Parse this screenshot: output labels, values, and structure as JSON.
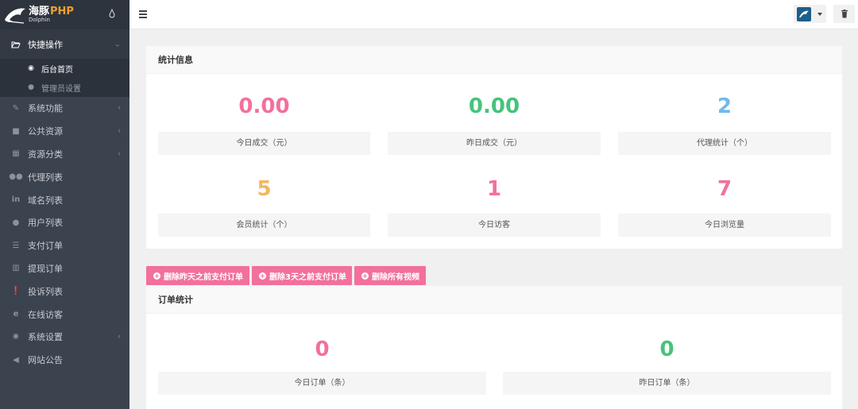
{
  "brand": {
    "name_cn": "海豚",
    "name_php": "PHP",
    "sub": "Dolphin"
  },
  "sidebar": {
    "items": [
      {
        "label": "快捷操作",
        "icon": "folder-open-icon",
        "open": true
      },
      {
        "label": "系统功能",
        "icon": "wrench-icon",
        "chevron": true
      },
      {
        "label": "公共资源",
        "icon": "video-camera-icon",
        "chevron": true
      },
      {
        "label": "资源分类",
        "icon": "grid-icon",
        "chevron": true
      },
      {
        "label": "代理列表",
        "icon": "users-icon"
      },
      {
        "label": "域名列表",
        "icon": "linkedin-icon"
      },
      {
        "label": "用户列表",
        "icon": "user-icon"
      },
      {
        "label": "支付订单",
        "icon": "database-icon"
      },
      {
        "label": "提现订单",
        "icon": "bank-icon"
      },
      {
        "label": "投诉列表",
        "icon": "exclamation-circle-icon"
      },
      {
        "label": "在线访客",
        "icon": "internet-explorer-icon"
      },
      {
        "label": "系统设置",
        "icon": "gear-icon",
        "chevron": true
      },
      {
        "label": "网站公告",
        "icon": "bullhorn-icon"
      }
    ],
    "sub_items": [
      {
        "label": "后台首页",
        "icon": "dashboard-icon",
        "active": true
      },
      {
        "label": "管理员设置",
        "icon": "user-icon"
      }
    ]
  },
  "stats_panel": {
    "title": "统计信息",
    "stats": [
      {
        "value": "0.00",
        "label": "今日成交（元）",
        "color": "#f2709c"
      },
      {
        "value": "0.00",
        "label": "昨日成交（元）",
        "color": "#46c37b"
      },
      {
        "value": "2",
        "label": "代理统计（个）",
        "color": "#70b9eb"
      },
      {
        "value": "5",
        "label": "会员统计（个）",
        "color": "#f3b760"
      },
      {
        "value": "1",
        "label": "今日访客",
        "color": "#f2709c"
      },
      {
        "value": "7",
        "label": "今日浏览量",
        "color": "#f2709c"
      }
    ]
  },
  "actions": [
    "删除昨天之前支付订单",
    "删除3天之前支付订单",
    "删除所有视频"
  ],
  "orders_panel": {
    "title": "订单统计",
    "stats": [
      {
        "value": "0",
        "label": "今日订单（条）",
        "color": "#f2709c"
      },
      {
        "value": "0",
        "label": "昨日订单（条）",
        "color": "#46c37b"
      }
    ]
  }
}
